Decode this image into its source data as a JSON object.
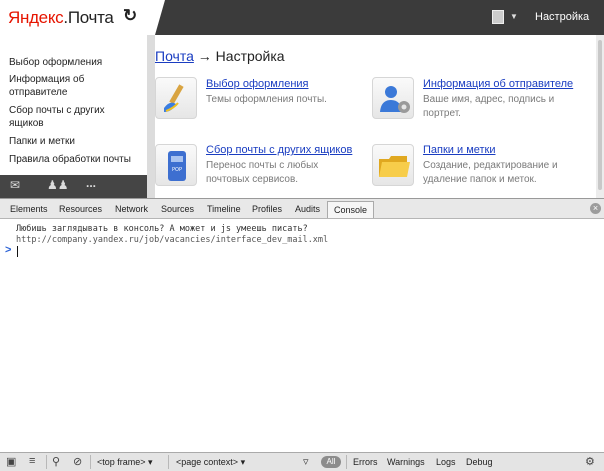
{
  "header": {
    "logo_brand": "Яндекс",
    "logo_dot": ".",
    "logo_service": "Почта",
    "refresh_icon": "refresh-icon",
    "settings_label": "Настройка"
  },
  "sidebar": {
    "items": [
      "Выбор оформления",
      "Информация об отправителе",
      "Сбор почты с других ящиков",
      "Папки и метки",
      "Правила обработки почты"
    ],
    "bottom_icons": [
      "mail-icon",
      "contacts-icon",
      "more-icon"
    ],
    "more_label": "..."
  },
  "main": {
    "breadcrumb_link": "Почта",
    "breadcrumb_arrow": "→",
    "breadcrumb_current": "Настройка",
    "cards": [
      {
        "icon": "brush-icon",
        "title": "Выбор оформления",
        "desc": "Темы оформления почты."
      },
      {
        "icon": "user-gear-icon",
        "title": "Информация об отправителе",
        "desc": "Ваше имя, адрес, подпись и портрет."
      },
      {
        "icon": "mailbox-icon",
        "title": "Сбор почты с других ящиков",
        "desc": "Перенос почты с любых почтовых сервисов."
      },
      {
        "icon": "folders-icon",
        "title": "Папки и метки",
        "desc": "Создание, редактирование и удаление папок и меток."
      }
    ]
  },
  "devtools": {
    "tabs": [
      "Elements",
      "Resources",
      "Network",
      "Sources",
      "Timeline",
      "Profiles",
      "Audits",
      "Console"
    ],
    "active_tab": "Console",
    "close_symbol": "×",
    "console_lines": [
      "Любишь заглядывать в консоль? А может и js умеешь писать?",
      "http://company.yandex.ru/job/vacancies/interface_dev_mail.xml"
    ],
    "prompt_symbol": ">",
    "statusbar": {
      "frame_select": "<top frame>",
      "context_select": "<page context>",
      "filter_all": "All",
      "filters": [
        "Errors",
        "Warnings",
        "Logs",
        "Debug"
      ]
    }
  }
}
